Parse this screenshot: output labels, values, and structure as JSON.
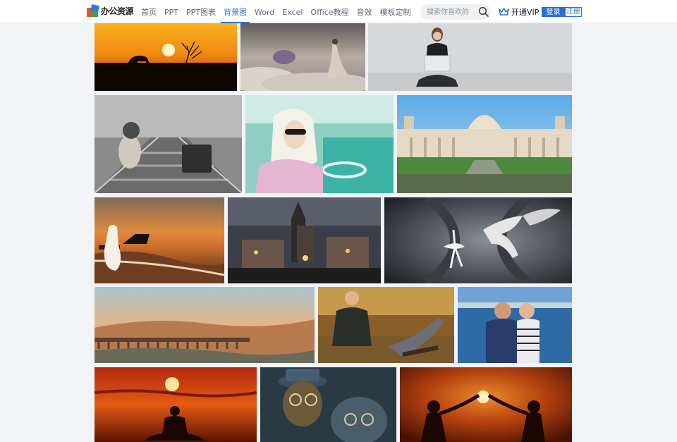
{
  "header": {
    "logo_text": "办公资源",
    "nav": [
      {
        "label": "首页",
        "active": false
      },
      {
        "label": "PPT",
        "active": false
      },
      {
        "label": "PPT图表",
        "active": false
      },
      {
        "label": "背景图",
        "active": true
      },
      {
        "label": "Word",
        "active": false
      },
      {
        "label": "Excel",
        "active": false
      },
      {
        "label": "Office教程",
        "active": false
      },
      {
        "label": "音效",
        "active": false
      },
      {
        "label": "模板定制",
        "active": false
      }
    ],
    "search": {
      "placeholder": "搜索你喜欢的",
      "icon": "search-icon"
    },
    "vip_label": "开通VIP",
    "login_label": "登录",
    "register_label": "注册"
  },
  "colors": {
    "accent": "#2b6fd2",
    "page_bg": "#f1f3f6"
  },
  "gallery": {
    "images": [
      {
        "subject": "sunset-elephant-silhouette"
      },
      {
        "subject": "fantasy-woman-clouds-island"
      },
      {
        "subject": "woman-laptop-sitting"
      },
      {
        "subject": "pug-railway-suitcase-bw"
      },
      {
        "subject": "woman-headscarf-vintage-car"
      },
      {
        "subject": "palace-fountain-columns"
      },
      {
        "subject": "woman-piano-beach-sunset"
      },
      {
        "subject": "prague-bridge-tower-night"
      },
      {
        "subject": "ballerina-pegasus-tunnel"
      },
      {
        "subject": "viaduct-landscape-dusk"
      },
      {
        "subject": "couple-relaxing-autumn"
      },
      {
        "subject": "couple-phone-seaside"
      },
      {
        "subject": "yoga-silhouette-sunset"
      },
      {
        "subject": "bronze-statues-glasses"
      },
      {
        "subject": "two-women-holding-sun"
      }
    ]
  }
}
